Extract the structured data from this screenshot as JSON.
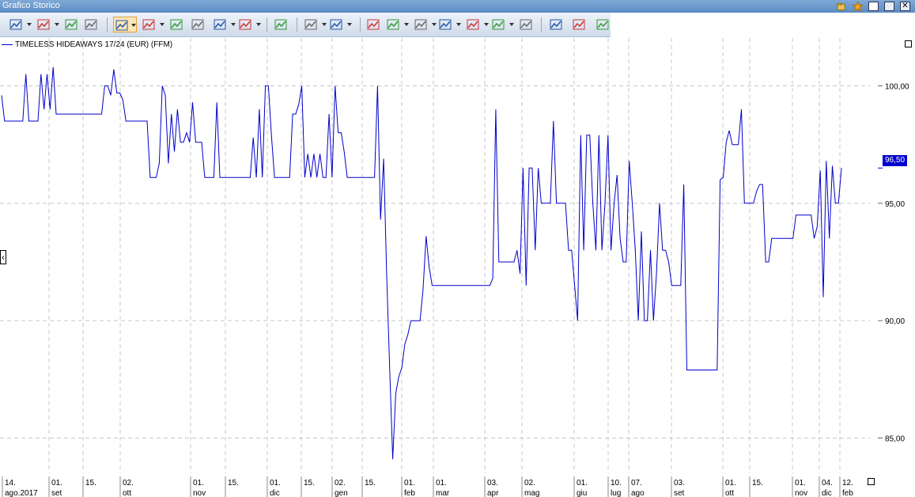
{
  "window": {
    "title": "Grafico Storico"
  },
  "legend": {
    "instrument": "TIMELESS HIDEAWAYS 17/24 (EUR) (FFM)"
  },
  "current_price": "96,50",
  "colors": {
    "series": "#0000cc",
    "titlebar": "#6b97cc",
    "toolbar": "#dde6f1"
  },
  "toolbar": {
    "buttons": [
      {
        "name": "chart-type-icon"
      },
      {
        "name": "compare-icon"
      },
      {
        "name": "add-indicator-icon"
      },
      {
        "name": "remove-indicator-icon"
      },
      {
        "name": "line-chart-icon"
      },
      {
        "name": "drawing-line-icon"
      },
      {
        "name": "bar-chart-icon"
      },
      {
        "name": "ohlc-icon"
      },
      {
        "name": "candlestick-icon"
      },
      {
        "name": "indicators-icon"
      },
      {
        "name": "trend-icon"
      },
      {
        "name": "style-icon"
      },
      {
        "name": "grid-icon"
      },
      {
        "name": "delete-drawing-icon"
      },
      {
        "name": "zoom-icon"
      },
      {
        "name": "cursor-icon"
      },
      {
        "name": "pen-icon"
      },
      {
        "name": "shape-icon"
      },
      {
        "name": "notes-icon"
      },
      {
        "name": "clipboard-icon"
      },
      {
        "name": "copy-icon"
      },
      {
        "name": "print-icon"
      },
      {
        "name": "export-icon"
      }
    ]
  },
  "chart_data": {
    "type": "line",
    "series": [
      {
        "name": "TIMELESS HIDEAWAYS 17/24 (EUR) (FFM)"
      }
    ],
    "ylim": [
      83.5,
      101.5
    ],
    "y_ticks": [
      "100,00",
      "95,00",
      "90,00",
      "85,00"
    ],
    "y_tick_values": [
      100,
      95,
      90,
      85
    ],
    "x_ticks": [
      {
        "day": "14.",
        "month": "ago.2017"
      },
      {
        "day": "01.",
        "month": "set"
      },
      {
        "day": "15.",
        "month": ""
      },
      {
        "day": "02.",
        "month": "ott"
      },
      {
        "day": "01.",
        "month": "nov"
      },
      {
        "day": "15.",
        "month": ""
      },
      {
        "day": "01.",
        "month": "dic"
      },
      {
        "day": "15.",
        "month": ""
      },
      {
        "day": "02.",
        "month": "gen"
      },
      {
        "day": "15.",
        "month": ""
      },
      {
        "day": "01.",
        "month": "feb"
      },
      {
        "day": "01.",
        "month": "mar"
      },
      {
        "day": "03.",
        "month": "apr"
      },
      {
        "day": "02.",
        "month": "mag"
      },
      {
        "day": "01.",
        "month": "giu"
      },
      {
        "day": "10.",
        "month": "lug"
      },
      {
        "day": "07.",
        "month": "ago"
      },
      {
        "day": "03.",
        "month": "set"
      },
      {
        "day": "01.",
        "month": "ott"
      },
      {
        "day": "15.",
        "month": ""
      },
      {
        "day": "01.",
        "month": "nov"
      },
      {
        "day": "04.",
        "month": "dic"
      },
      {
        "day": "12.",
        "month": "feb"
      }
    ],
    "values": [
      99.6,
      98.5,
      98.5,
      98.5,
      98.5,
      98.5,
      98.5,
      98.5,
      100.5,
      98.5,
      98.5,
      98.5,
      98.5,
      100.5,
      99.0,
      100.5,
      99.0,
      100.8,
      98.8,
      98.8,
      98.8,
      98.8,
      98.8,
      98.8,
      98.8,
      98.8,
      98.8,
      98.8,
      98.8,
      98.8,
      98.8,
      98.8,
      98.8,
      98.8,
      100.0,
      100.0,
      99.6,
      100.7,
      99.7,
      99.7,
      99.4,
      98.5,
      98.5,
      98.5,
      98.5,
      98.5,
      98.5,
      98.5,
      98.5,
      96.1,
      96.1,
      96.1,
      96.7,
      100.0,
      99.6,
      96.7,
      98.8,
      97.2,
      99.0,
      97.6,
      97.6,
      98.0,
      97.6,
      99.3,
      97.6,
      97.6,
      97.6,
      96.1,
      96.1,
      96.1,
      96.1,
      99.3,
      96.1,
      96.1,
      96.1,
      96.1,
      96.1,
      96.1,
      96.1,
      96.1,
      96.1,
      96.1,
      96.1,
      97.8,
      96.1,
      99.0,
      96.1,
      100.0,
      100.0,
      97.9,
      96.1,
      96.1,
      96.1,
      96.1,
      96.1,
      96.1,
      98.8,
      98.8,
      99.2,
      100.0,
      96.1,
      97.1,
      96.1,
      97.1,
      96.1,
      97.1,
      96.1,
      96.1,
      98.8,
      96.1,
      100.0,
      98.0,
      98.0,
      97.2,
      96.1,
      96.1,
      96.1,
      96.1,
      96.1,
      96.1,
      96.1,
      96.1,
      96.1,
      96.1,
      100.0,
      94.3,
      96.9,
      92.0,
      88.0,
      84.1,
      86.9,
      87.6,
      88.0,
      89.0,
      89.4,
      90.0,
      90.0,
      90.0,
      90.0,
      91.3,
      93.6,
      92.3,
      91.5,
      91.5,
      91.5,
      91.5,
      91.5,
      91.5,
      91.5,
      91.5,
      91.5,
      91.5,
      91.5,
      91.5,
      91.5,
      91.5,
      91.5,
      91.5,
      91.5,
      91.5,
      91.5,
      91.5,
      91.8,
      99.0,
      92.5,
      92.5,
      92.5,
      92.5,
      92.5,
      92.5,
      93.0,
      92.0,
      96.5,
      91.5,
      96.5,
      96.5,
      93.0,
      96.5,
      95.0,
      95.0,
      95.0,
      95.0,
      98.5,
      95.0,
      95.0,
      95.0,
      95.0,
      93.0,
      93.0,
      91.5,
      90.0,
      97.9,
      93.0,
      97.9,
      97.9,
      95.0,
      93.0,
      97.9,
      93.0,
      95.0,
      97.9,
      93.0,
      95.0,
      96.2,
      93.5,
      92.5,
      92.5,
      96.8,
      95.0,
      93.0,
      90.0,
      93.8,
      90.0,
      90.0,
      93.0,
      90.0,
      92.0,
      95.0,
      93.0,
      93.0,
      92.5,
      91.5,
      91.5,
      91.5,
      91.5,
      95.8,
      87.9,
      87.9,
      87.9,
      87.9,
      87.9,
      87.9,
      87.9,
      87.9,
      87.9,
      87.9,
      87.9,
      96.0,
      96.1,
      97.6,
      98.1,
      97.5,
      97.5,
      97.5,
      99.0,
      95.0,
      95.0,
      95.0,
      95.0,
      95.5,
      95.8,
      95.8,
      92.5,
      92.5,
      93.5,
      93.5,
      93.5,
      93.5,
      93.5,
      93.5,
      93.5,
      93.5,
      94.5,
      94.5,
      94.5,
      94.5,
      94.5,
      94.5,
      93.5,
      94.0,
      96.4,
      91.0,
      96.8,
      93.5,
      96.6,
      95.0,
      95.0,
      96.5
    ],
    "grid": true,
    "legend_position": "top-left"
  }
}
